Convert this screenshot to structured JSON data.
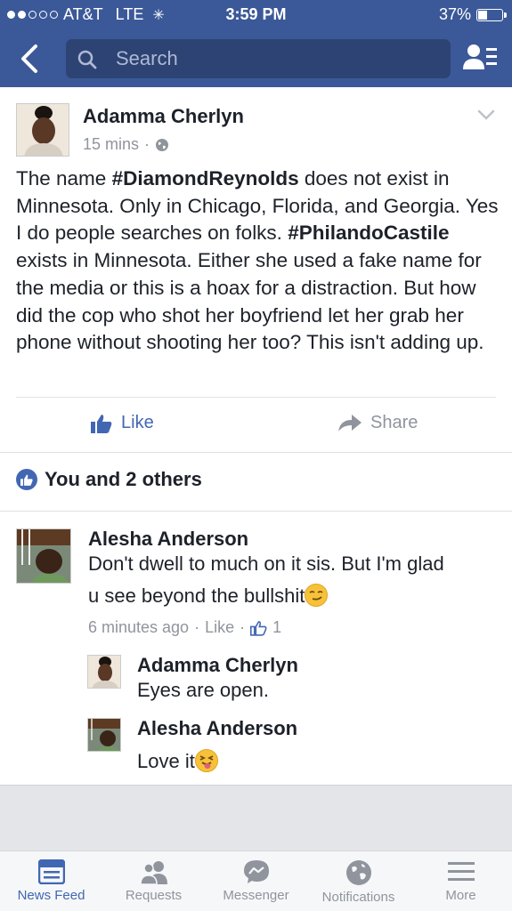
{
  "status_bar": {
    "carrier": "AT&T",
    "network": "LTE",
    "time": "3:59 PM",
    "battery": "37%",
    "battery_level": 0.37
  },
  "search": {
    "placeholder": "Search"
  },
  "post": {
    "author": "Adamma Cherlyn",
    "time": "15 mins",
    "privacy_separator": "·",
    "text_parts": [
      "The name ",
      "#DiamondReynolds",
      " does not exist in Minnesota. Only in Chicago, Florida, and Georgia. Yes I do people searches on folks. ",
      "#PhilandoCastile",
      " exists in Minnesota. Either she used a fake name for the media or this is a hoax for a distraction. But how did the cop who shot her boyfriend let her grab her phone without shooting her too? This isn't adding up."
    ],
    "like_label": "Like",
    "share_label": "Share",
    "likes_summary": "You and 2 others"
  },
  "comments": [
    {
      "author": "Alesha Anderson",
      "text_line1": "Don't dwell to much on it sis. But I'm glad",
      "text_line2": "u see beyond the bullshit",
      "time": "6 minutes ago",
      "sep": "·",
      "like_label": "Like",
      "like_count": "1",
      "replies": [
        {
          "author": "Adamma Cherlyn",
          "text": "Eyes are open."
        },
        {
          "author": "Alesha Anderson",
          "text": "Love it"
        }
      ]
    }
  ],
  "tabs": [
    {
      "label": "News Feed",
      "icon": "news-feed-icon",
      "active": true
    },
    {
      "label": "Requests",
      "icon": "requests-icon"
    },
    {
      "label": "Messenger",
      "icon": "messenger-icon"
    },
    {
      "label": "Notifications",
      "icon": "globe-icon"
    },
    {
      "label": "More",
      "icon": "menu-icon"
    }
  ],
  "colors": {
    "brand": "#3b5998",
    "link": "#4267b2",
    "muted": "#90949c"
  }
}
